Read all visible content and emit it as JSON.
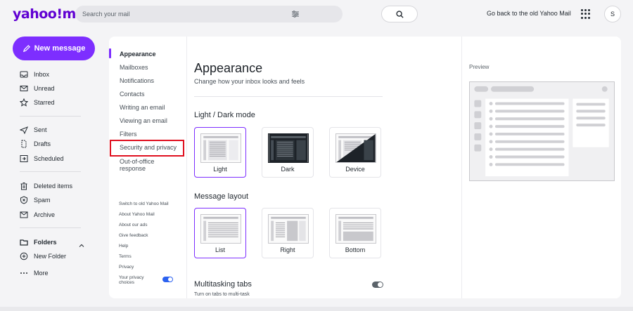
{
  "header": {
    "logo": "yahoo!mail",
    "search_placeholder": "Search your mail",
    "back_link": "Go back to the old Yahoo Mail",
    "avatar_initial": "S"
  },
  "nav": {
    "compose_label": "New message",
    "items": [
      {
        "label": "Inbox",
        "icon": "inbox-icon"
      },
      {
        "label": "Unread",
        "icon": "envelope-icon"
      },
      {
        "label": "Starred",
        "icon": "star-icon"
      },
      {
        "label": "Sent",
        "icon": "send-icon"
      },
      {
        "label": "Drafts",
        "icon": "draft-icon"
      },
      {
        "label": "Scheduled",
        "icon": "scheduled-icon"
      },
      {
        "label": "Deleted items",
        "icon": "trash-icon"
      },
      {
        "label": "Spam",
        "icon": "spam-icon"
      },
      {
        "label": "Archive",
        "icon": "archive-icon"
      }
    ],
    "folders_label": "Folders",
    "new_folder_label": "New Folder",
    "more_label": "More"
  },
  "settings_nav": {
    "items": [
      "Appearance",
      "Mailboxes",
      "Notifications",
      "Contacts",
      "Writing an email",
      "Viewing an email",
      "Filters",
      "Security and privacy"
    ],
    "out_of_office_1": "Out-of-office",
    "out_of_office_2": "response",
    "footer": [
      "Switch to old Yahoo Mail",
      "About Yahoo Mail",
      "About our ads",
      "Give feedback",
      "Help",
      "Terms",
      "Privacy"
    ],
    "privacy_choices_1": "Your privacy",
    "privacy_choices_2": "choices"
  },
  "content": {
    "title": "Appearance",
    "subtitle": "Change how your inbox looks and feels",
    "mode_heading": "Light / Dark mode",
    "mode_options": [
      "Light",
      "Dark",
      "Device"
    ],
    "layout_heading": "Message layout",
    "layout_options": [
      "List",
      "Right",
      "Bottom"
    ],
    "multitask_heading": "Multitasking tabs",
    "multitask_sub": "Turn on tabs to multi-task"
  },
  "preview": {
    "label": "Preview"
  },
  "colors": {
    "accent": "#7d2eff",
    "brand": "#6001d2",
    "highlight": "#e0101f"
  }
}
